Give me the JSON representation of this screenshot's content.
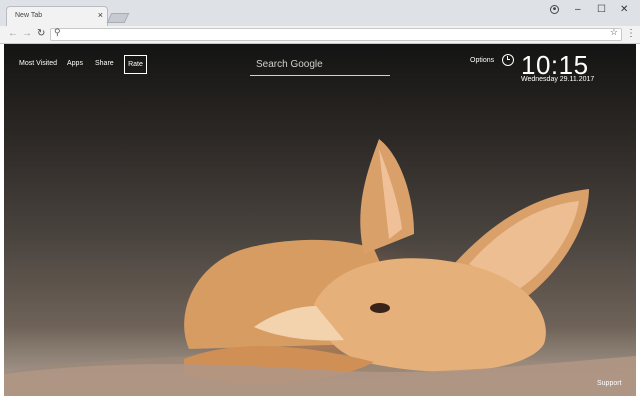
{
  "browser": {
    "tab_title": "New Tab",
    "tab_close": "×",
    "window_controls": {
      "minimize": "–",
      "maximize": "☐",
      "close": "✕"
    },
    "nav": {
      "back": "←",
      "forward": "→",
      "reload": "↻"
    },
    "address_value": "",
    "address_placeholder": "",
    "icons": [
      "account-icon",
      "search-icon",
      "star-icon",
      "menu-icon"
    ]
  },
  "newtab": {
    "links": [
      "Most Visited",
      "Apps",
      "Share",
      "Rate"
    ],
    "search_placeholder": "Search Google",
    "options_label": "Options",
    "time": "10:15",
    "date": "Wednesday  29.11.2017",
    "support_label": "Support"
  }
}
